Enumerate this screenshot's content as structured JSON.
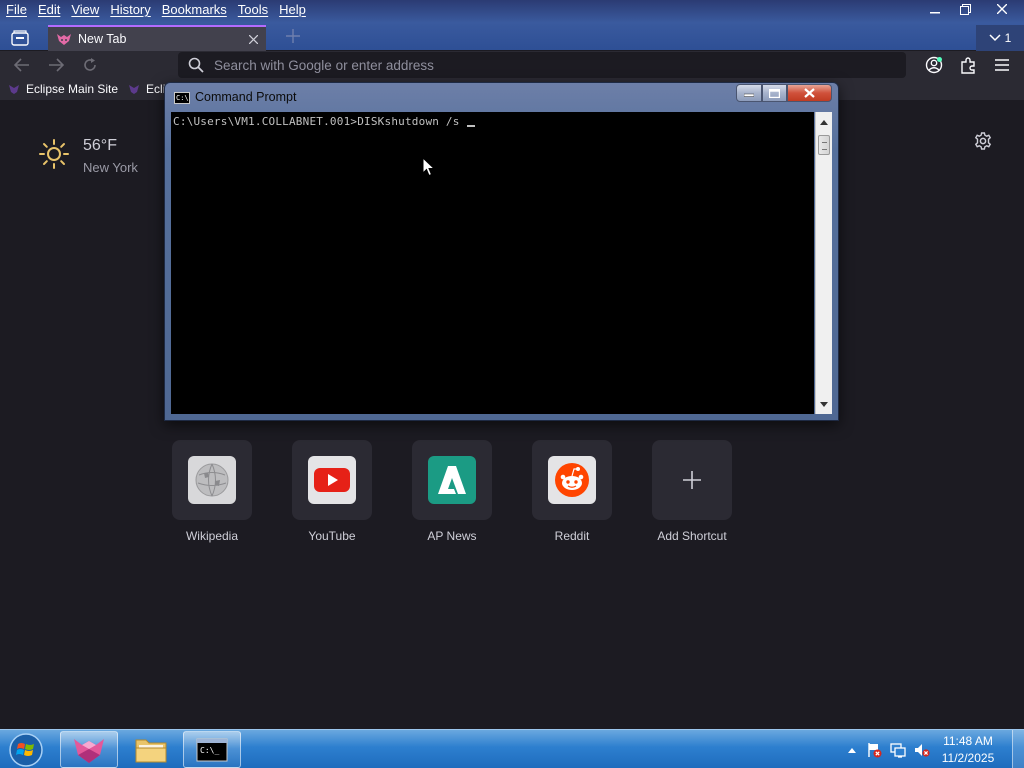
{
  "browser": {
    "menu": [
      "File",
      "Edit",
      "View",
      "History",
      "Bookmarks",
      "Tools",
      "Help"
    ],
    "tab": {
      "title": "New Tab"
    },
    "tab_count": "1",
    "urlbar": {
      "placeholder": "Search with Google or enter address"
    },
    "bookmarks": [
      "Eclipse Main Site",
      "Ecli"
    ]
  },
  "newtab": {
    "weather": {
      "temperature": "56°F",
      "city": "New York"
    },
    "shortcuts": [
      {
        "label": "Wikipedia",
        "icon": "wikipedia-icon"
      },
      {
        "label": "YouTube",
        "icon": "youtube-icon"
      },
      {
        "label": "AP News",
        "icon": "ap-news-icon"
      },
      {
        "label": "Reddit",
        "icon": "reddit-icon"
      },
      {
        "label": "Add Shortcut",
        "icon": "plus-icon"
      }
    ]
  },
  "cmd": {
    "title": "Command Prompt",
    "prompt": "C:\\Users\\VM1.COLLABNET.001>",
    "command": "DISKshutdown /s "
  },
  "taskbar": {
    "time": "11:48 AM",
    "date": "11/2/2025"
  },
  "colors": {
    "accent": "#b36bff",
    "taskbar": "#2d7fcf",
    "page_bg": "#1c1b22",
    "youtube": "#e62117",
    "ap_news": "#1b9b84",
    "reddit": "#ff4500"
  }
}
